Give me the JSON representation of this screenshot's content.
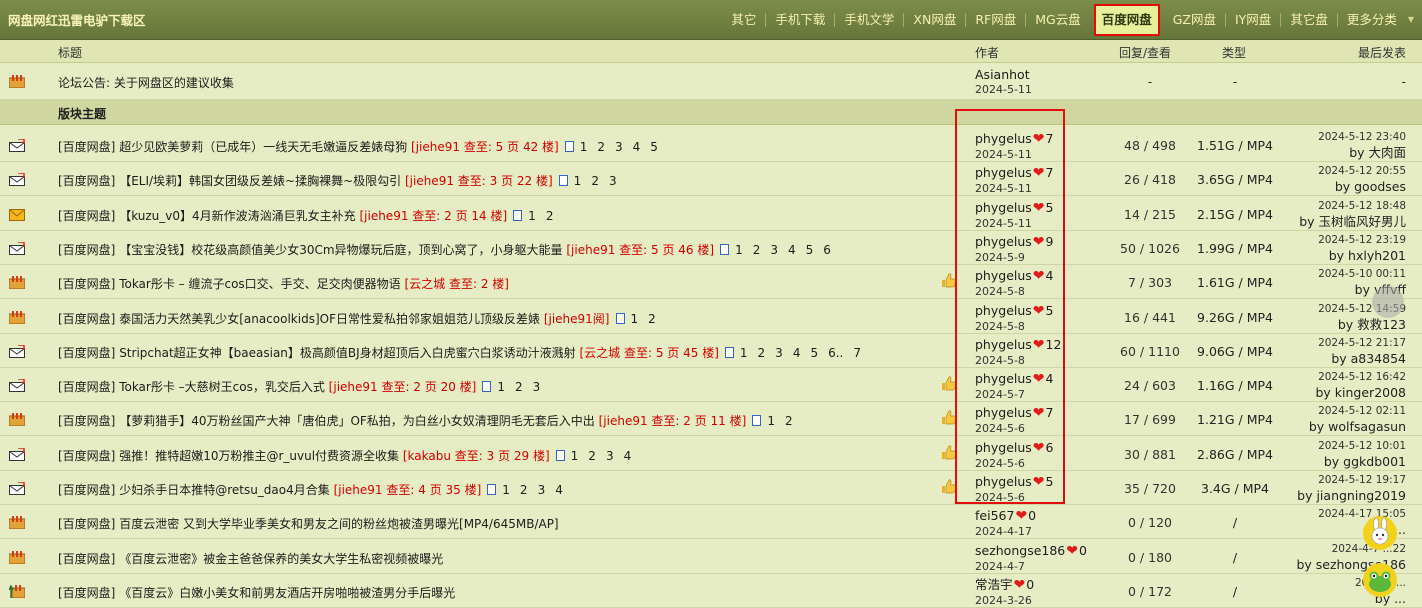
{
  "header": {
    "forum_title": "网盘网红迅雷电驴下载区",
    "categories": [
      {
        "label": "其它"
      },
      {
        "label": "手机下载"
      },
      {
        "label": "手机文学"
      },
      {
        "label": "XN网盘"
      },
      {
        "label": "RF网盘"
      },
      {
        "label": "MG云盘"
      },
      {
        "label": "百度网盘",
        "active": true
      },
      {
        "label": "GZ网盘"
      },
      {
        "label": "IY网盘"
      },
      {
        "label": "其它盘"
      },
      {
        "label": "更多分类"
      }
    ]
  },
  "columns": {
    "title": "标题",
    "author": "作者",
    "replies": "回复/查看",
    "type": "类型",
    "last": "最后发表"
  },
  "announcement": {
    "title": "论坛公告: 关于网盘区的建议收集",
    "author": "Asianhot",
    "date": "2024-5-11",
    "replies": "-",
    "type": "-",
    "last": "-"
  },
  "section_title": "版块主题",
  "threads": [
    {
      "prefix": "[百度网盘]",
      "title": " 超少见欧美萝莉（已成年）一线天无毛嫩逼反差婊母狗 ",
      "hl": "[jiehe91 查至: 5 页 42 楼]",
      "pages": [
        "1",
        "2",
        "3",
        "4",
        "5"
      ],
      "author": "phygelus",
      "count": "7",
      "date": "2024-5-11",
      "replies": "48 / 498",
      "type": "1.51G / MP4",
      "ldate": "2024-5-12 23:40",
      "lby": "by 大肉面",
      "icon": "hot"
    },
    {
      "prefix": "[百度网盘]",
      "title": " 【ELI/埃莉】韩国女团级反差婊~揉胸裸舞~极限勾引 ",
      "hl": "[jiehe91 查至: 3 页 22 楼]",
      "pages": [
        "1",
        "2",
        "3"
      ],
      "author": "phygelus",
      "count": "7",
      "date": "2024-5-11",
      "replies": "26 / 418",
      "type": "3.65G / MP4",
      "ldate": "2024-5-12 20:55",
      "lby": "by goodses",
      "icon": "hot"
    },
    {
      "prefix": "[百度网盘]",
      "title": " 【kuzu_v0】4月新作波涛汹涌巨乳女主补充 ",
      "hl": "[jiehe91 查至: 2 页 14 楼]",
      "pages": [
        "1",
        "2"
      ],
      "author": "phygelus",
      "count": "5",
      "date": "2024-5-11",
      "replies": "14 / 215",
      "type": "2.15G / MP4",
      "ldate": "2024-5-12 18:48",
      "lby": "by 玉树临风好男儿",
      "icon": "new"
    },
    {
      "prefix": "[百度网盘]",
      "title": " 【宝宝没钱】校花级高颜值美少女30Cm异物爆玩后庭，顶到心窝了，小身躯大能量 ",
      "hl": "[jiehe91 查至: 5 页 46 楼]",
      "pages": [
        "1",
        "2",
        "3",
        "4",
        "5",
        "6"
      ],
      "author": "phygelus",
      "count": "9",
      "date": "2024-5-9",
      "replies": "50 / 1026",
      "type": "1.99G / MP4",
      "ldate": "2024-5-12 23:19",
      "lby": "by hxlyh201",
      "icon": "hot"
    },
    {
      "prefix": "[百度网盘]",
      "title": " Tokar彤卡 – 缠流子cos口交、手交、足交肉便器物语 ",
      "hl": "[云之城 查至: 2 楼]",
      "pages": [],
      "author": "phygelus",
      "count": "4",
      "date": "2024-5-8",
      "replies": "7 / 303",
      "type": "1.61G / MP4",
      "ldate": "2024-5-10 00:11",
      "lby": "by vffvff",
      "icon": "norm",
      "thumb": true
    },
    {
      "prefix": "[百度网盘]",
      "title": " 泰国活力天然美乳少女[anacoolkids]OF日常性爱私拍邻家姐姐范儿顶级反差婊 ",
      "hl": "[jiehe91阅]",
      "pages": [
        "1",
        "2"
      ],
      "author": "phygelus",
      "count": "5",
      "date": "2024-5-8",
      "replies": "16 / 441",
      "type": "9.26G / MP4",
      "ldate": "2024-5-12 14:59",
      "lby": "by 救救123",
      "icon": "norm"
    },
    {
      "prefix": "[百度网盘]",
      "title": " Stripchat超正女神【baeasian】极高颜值BJ身材超顶后入白虎蜜穴白浆诱动汁液溅射 ",
      "hl": "[云之城 查至: 5 页 45 楼]",
      "pages": [
        "1",
        "2",
        "3",
        "4",
        "5",
        "6..",
        "7"
      ],
      "author": "phygelus",
      "count": "12",
      "date": "2024-5-8",
      "replies": "60 / 1110",
      "type": "9.06G / MP4",
      "ldate": "2024-5-12 21:17",
      "lby": "by a834854",
      "icon": "hot"
    },
    {
      "prefix": "[百度网盘]",
      "title": " Tokar彤卡 –大慈树王cos，乳交后入式 ",
      "hl": "[jiehe91 查至: 2 页 20 楼]",
      "pages": [
        "1",
        "2",
        "3"
      ],
      "author": "phygelus",
      "count": "4",
      "date": "2024-5-7",
      "replies": "24 / 603",
      "type": "1.16G / MP4",
      "ldate": "2024-5-12 16:42",
      "lby": "by kinger2008",
      "icon": "hot",
      "thumb": true
    },
    {
      "prefix": "[百度网盘]",
      "title": " 【萝莉猎手】40万粉丝国产大神「唐伯虎」OF私拍，为白丝小女奴清理阴毛无套后入中出 ",
      "hl": "[jiehe91 查至: 2 页 11 楼]",
      "pages": [
        "1",
        "2"
      ],
      "author": "phygelus",
      "count": "7",
      "date": "2024-5-6",
      "replies": "17 / 699",
      "type": "1.21G / MP4",
      "ldate": "2024-5-12 02:11",
      "lby": "by wolfsagasun",
      "icon": "norm",
      "thumb": true
    },
    {
      "prefix": "[百度网盘]",
      "title": " 强推！推特超嫩10万粉推主@r_uvul付费资源全收集 ",
      "hl": "[kakabu 查至: 3 页 29 楼]",
      "pages": [
        "1",
        "2",
        "3",
        "4"
      ],
      "author": "phygelus",
      "count": "6",
      "date": "2024-5-6",
      "replies": "30 / 881",
      "type": "2.86G / MP4",
      "ldate": "2024-5-12 10:01",
      "lby": "by ggkdb001",
      "icon": "hot",
      "thumb": true
    },
    {
      "prefix": "[百度网盘]",
      "title": " 少妇杀手日本推特@retsu_dao4月合集 ",
      "hl": "[jiehe91 查至: 4 页 35 楼]",
      "pages": [
        "1",
        "2",
        "3",
        "4"
      ],
      "author": "phygelus",
      "count": "5",
      "date": "2024-5-6",
      "replies": "35 / 720",
      "type": "3.4G / MP4",
      "ldate": "2024-5-12 19:17",
      "lby": "by jiangning2019",
      "icon": "hot",
      "thumb": true
    },
    {
      "prefix": "[百度网盘]",
      "title": " 百度云泄密 又到大学毕业季美女和男友之间的粉丝炮被渣男曝光[MP4/645MB/AP]",
      "hl": "",
      "pages": [],
      "author": "fei567",
      "count": "0",
      "date": "2024-4-17",
      "replies": "0 / 120",
      "type": "/",
      "ldate": "2024-4-17 15:05",
      "lby": "by ...",
      "icon": "norm"
    },
    {
      "prefix": "[百度网盘]",
      "title": " 《百度云泄密》被金主爸爸保养的美女大学生私密视频被曝光",
      "hl": "",
      "pages": [],
      "author": "sezhongse186",
      "count": "0",
      "date": "2024-4-7",
      "replies": "0 / 180",
      "type": "/",
      "ldate": "2024-4-7 ...22",
      "lby": "by sezhongse186",
      "icon": "norm"
    },
    {
      "prefix": "[百度网盘]",
      "title": " 《百度云》白嫩小美女和前男友酒店开房啪啪被渣男分手后曝光",
      "hl": "",
      "pages": [],
      "author": "常浩宇",
      "count": "0",
      "date": "2024-3-26",
      "replies": "0 / 172",
      "type": "/",
      "ldate": "2024-3-...",
      "lby": "by ...",
      "icon": "up"
    }
  ]
}
